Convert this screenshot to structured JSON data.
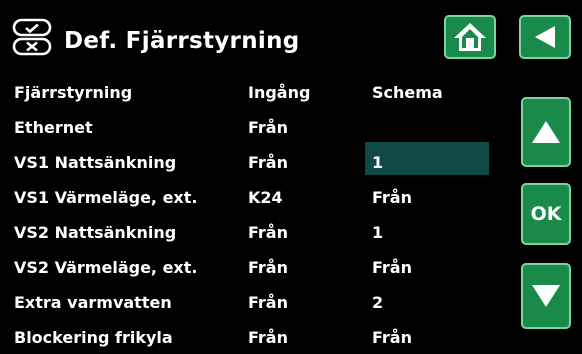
{
  "header": {
    "title": "Def. Fjärrstyrning",
    "icons": [
      "remote-control-icon",
      "home-icon",
      "back-arrow-icon"
    ]
  },
  "columns": {
    "name": "Fjärrstyrning",
    "input": "Ingång",
    "schedule": "Schema"
  },
  "rows": [
    {
      "name": "Ethernet",
      "input": "Från",
      "schedule": ""
    },
    {
      "name": "VS1 Nattsänkning",
      "input": "Från",
      "schedule": "1"
    },
    {
      "name": "VS1 Värmeläge, ext.",
      "input": "K24",
      "schedule": "Från"
    },
    {
      "name": "VS2 Nattsänkning",
      "input": "Från",
      "schedule": "1"
    },
    {
      "name": "VS2 Värmeläge, ext.",
      "input": "Från",
      "schedule": "Från"
    },
    {
      "name": "Extra varmvatten",
      "input": "Från",
      "schedule": "2"
    },
    {
      "name": "Blockering frikyla",
      "input": "Från",
      "schedule": "Från"
    }
  ],
  "nav": {
    "ok_label": "OK",
    "up_icon": "arrow-up-icon",
    "down_icon": "arrow-down-icon"
  },
  "colors": {
    "background": "#000000",
    "button": "#1a8a4a",
    "button_border": "#7fd3a0",
    "selection": "#0f4a48"
  }
}
